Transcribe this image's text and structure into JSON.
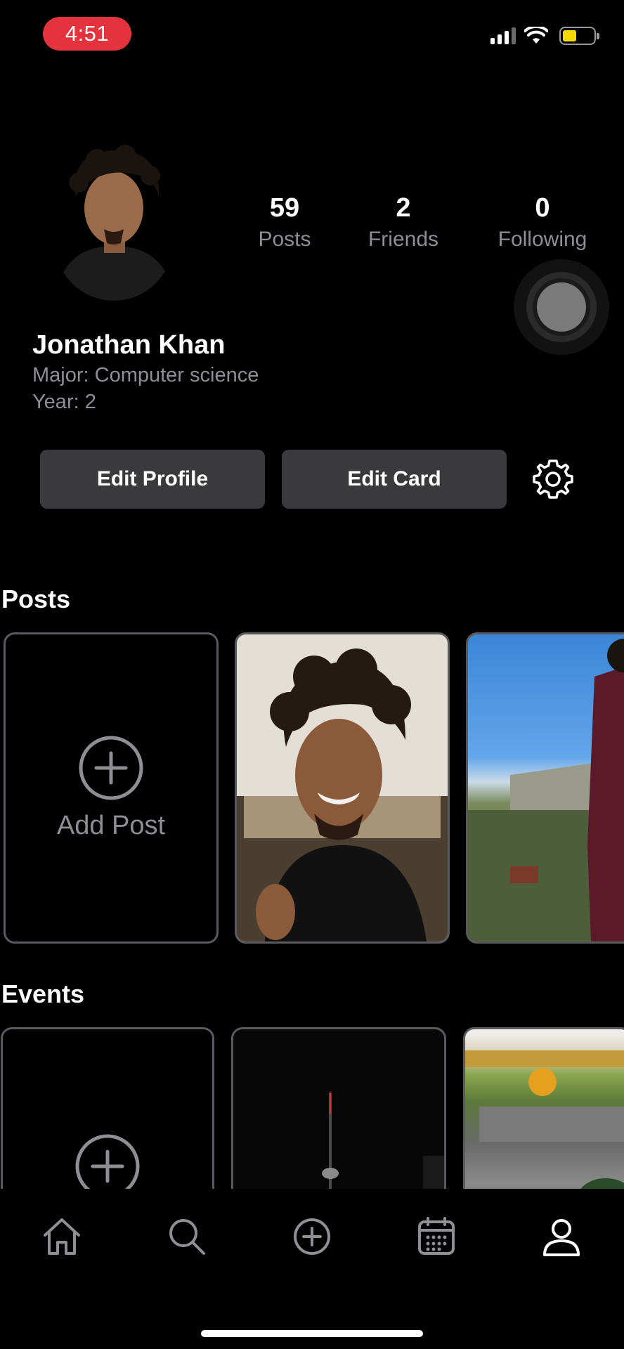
{
  "status_bar": {
    "time": "4:51"
  },
  "profile": {
    "name": "Jonathan Khan",
    "major": "Major: Computer science",
    "year": "Year: 2",
    "stats": [
      {
        "value": "59",
        "label": "Posts"
      },
      {
        "value": "2",
        "label": "Friends"
      },
      {
        "value": "0",
        "label": "Following"
      }
    ]
  },
  "actions": {
    "edit_profile": "Edit Profile",
    "edit_card": "Edit Card"
  },
  "sections": {
    "posts": {
      "title": "Posts",
      "add_label": "Add Post"
    },
    "events": {
      "title": "Events"
    }
  },
  "tabbar": {
    "items": [
      "home-icon",
      "search-icon",
      "add-circle-icon",
      "calendar-icon",
      "profile-icon"
    ]
  },
  "colors": {
    "accent_status": "#e5333d",
    "secondary_text": "#8e8e93",
    "button_bg": "#3a3a3c",
    "card_border": "#5a5a5e"
  }
}
